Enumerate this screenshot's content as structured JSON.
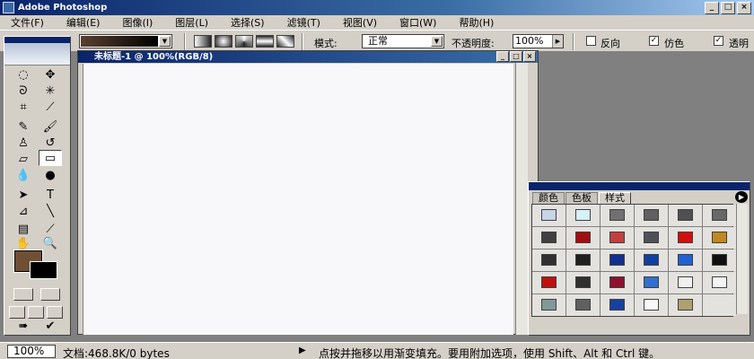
{
  "window": {
    "title": "Adobe Photoshop",
    "buttons": [
      "_",
      "□",
      "×"
    ]
  },
  "menu": [
    "文件(F)",
    "编辑(E)",
    "图像(I)",
    "图层(L)",
    "选择(S)",
    "滤镜(T)",
    "视图(V)",
    "窗口(W)",
    "帮助(H)"
  ],
  "options": {
    "mode_label": "模式:",
    "mode_value": "正常",
    "opacity_label": "不透明度:",
    "opacity_value": "100%",
    "reverse_label": "反向",
    "dither_label": "仿色",
    "transparency_label": "透明"
  },
  "document": {
    "title": "未标题-1 @ 100%(RGB/8)"
  },
  "palette": {
    "tabs": [
      "颜色",
      "色板",
      "样式"
    ],
    "active_tab": "样式",
    "swatches": [
      "#c8d4e8",
      "#d8f0f8",
      "#707070",
      "#606060",
      "#505050",
      "#686868",
      "#404040",
      "#a01010",
      "#c04040",
      "#505058",
      "#d01010",
      "#c08820",
      "#303030",
      "#202020",
      "#103090",
      "#1040a0",
      "#2060d0",
      "#101010",
      "#c01010",
      "#303030",
      "#901030",
      "#3070d0",
      "#f0f0f0",
      "#f4f4f4",
      "#809898",
      "#606060",
      "#1840a0",
      "#f8f8f8",
      "#b0a070",
      "#e4e2de"
    ]
  },
  "status": {
    "zoom": "100%",
    "doc_info": "文档:468.8K/0 bytes",
    "message": "点按并拖移以用渐变填充。要用附加选项，使用 Shift、Alt 和 Ctrl 键。"
  },
  "colors": {
    "foreground": "#705035",
    "background": "#000000"
  }
}
